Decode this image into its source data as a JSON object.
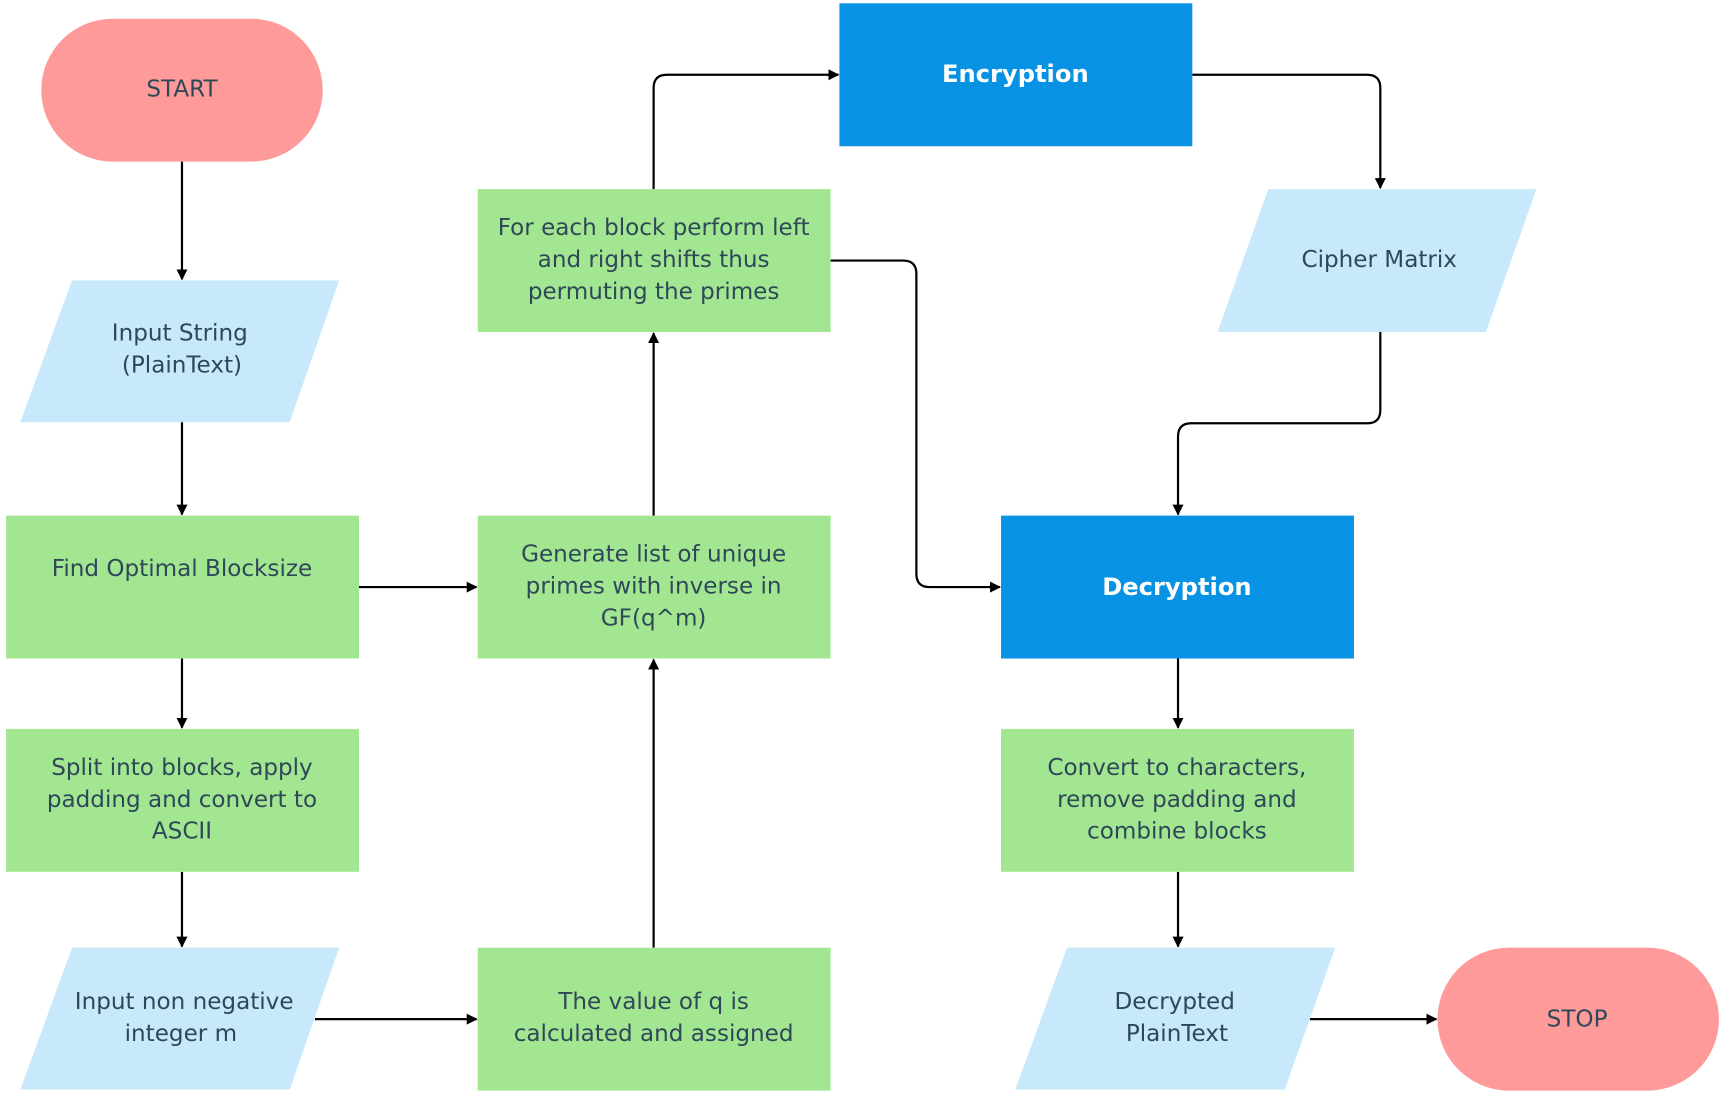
{
  "colors": {
    "terminal": "#fe9a9a",
    "io": "#c7e9fb",
    "process": "#a3e692",
    "crypto": "#0892e3",
    "text": "#2f4858",
    "arrow": "#000000"
  },
  "nodes": {
    "start": {
      "lines": [
        "START"
      ]
    },
    "input_string": {
      "lines": [
        "Input String",
        "(PlainText)"
      ]
    },
    "blocksize": {
      "lines": [
        "Find Optimal Blocksize"
      ]
    },
    "split": {
      "lines": [
        "Split into blocks, apply",
        "padding and convert to",
        "ASCII"
      ]
    },
    "input_m": {
      "lines": [
        "Input non negative",
        "integer m"
      ]
    },
    "q_value": {
      "lines": [
        "The value of q is",
        "calculated and assigned"
      ]
    },
    "primes": {
      "lines": [
        "Generate list of unique",
        "primes with inverse in",
        "GF(q^m)"
      ]
    },
    "shifts": {
      "lines": [
        "For each block perform left",
        "and right shifts thus",
        "permuting the primes"
      ]
    },
    "encryption": {
      "lines": [
        "Encryption"
      ]
    },
    "cipher": {
      "lines": [
        "Cipher Matrix"
      ]
    },
    "decryption": {
      "lines": [
        "Decryption"
      ]
    },
    "convert": {
      "lines": [
        "Convert to characters,",
        "remove padding and",
        "combine blocks"
      ]
    },
    "decrypted": {
      "lines": [
        "Decrypted",
        "PlainText"
      ]
    },
    "stop": {
      "lines": [
        "STOP"
      ]
    }
  }
}
